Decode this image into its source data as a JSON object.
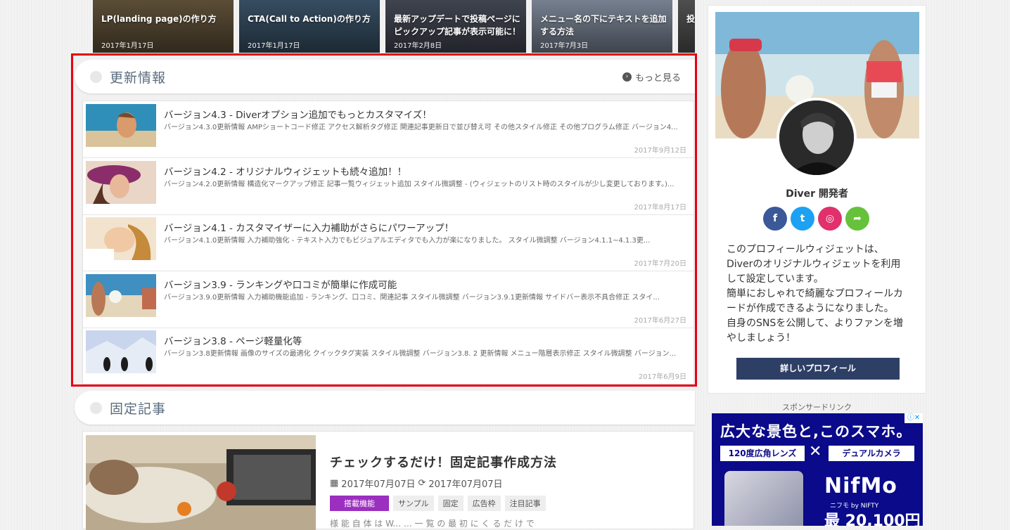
{
  "carousel": [
    {
      "title": "LP(landing page)の作り方",
      "date": "2017年1月17日",
      "bg": "#6b5a3f"
    },
    {
      "title": "CTA(Call to Action)の作り方",
      "date": "2017年1月17日",
      "bg": "#3f5a72"
    },
    {
      "title": "最新アップデートで投稿ページにピックアップ記事が表示可能に！",
      "date": "2017年2月8日",
      "bg": "#4a4f5c"
    },
    {
      "title": "メニュー名の下にテキストを追加する方法",
      "date": "2017年7月3日",
      "bg": "#8a96a8"
    },
    {
      "title": "投公",
      "date": "",
      "bg": "#5c5c5c"
    }
  ],
  "updates": {
    "heading": "更新情報",
    "more_label": "もっと見る",
    "items": [
      {
        "title": "バージョン4.3 - Diverオプション追加でもっとカスタマイズ！",
        "excerpt": "バージョン4.3.0更新情報 AMPショートコード修正 アクセス解析タグ修正 関連記事更新日で並び替え可 その他スタイル修正 その他プログラム修正 バージョン4...",
        "date": "2017年9月12日"
      },
      {
        "title": "バージョン4.2 - オリジナルウィジェットも続々追加！！",
        "excerpt": "バージョン4.2.0更新情報 構造化マークアップ修正 記事一覧ウィジェット追加 スタイル微調整 - (ウィジェットのリスト時のスタイルが少し変更しております。)...",
        "date": "2017年8月17日"
      },
      {
        "title": "バージョン4.1 - カスタマイザーに入力補助がさらにパワーアップ！",
        "excerpt": "バージョン4.1.0更新情報 入力補助強化 - テキスト入力でもビジュアルエディタでも入力が楽になりました。 スタイル微調整 バージョン4.1.1~4.1.3更...",
        "date": "2017年7月20日"
      },
      {
        "title": "バージョン3.9 - ランキングや口コミが簡単に作成可能",
        "excerpt": "バージョン3.9.0更新情報 入力補助機能追加 - ランキング、口コミ、関連記事 スタイル微調整 バージョン3.9.1更新情報 サイドバー表示不具合修正 スタイ...",
        "date": "2017年6月27日"
      },
      {
        "title": "バージョン3.8 - ページ軽量化等",
        "excerpt": "バージョン3.8更新情報 画像のサイズの最適化 クイックタグ実装 スタイル微調整 バージョン3.8. 2 更新情報 メニュー階層表示修正 スタイル微調整 バージョン...",
        "date": "2017年6月9日"
      }
    ]
  },
  "fixed": {
    "heading": "固定記事",
    "article_title": "チェックするだけ！固定記事作成方法",
    "published": "2017年07月07日",
    "updated": "2017年07月07日",
    "category": "搭載機能",
    "tags": [
      "サンプル",
      "固定",
      "広告枠",
      "注目記事"
    ],
    "excerpt_cut": "様 能 自 体 は W...              …                              一 覧 の 最 初 に く る だ け で"
  },
  "profile": {
    "name": "Diver 開発者",
    "socials": [
      {
        "icon": "f",
        "color": "#3b5998",
        "name": "facebook-icon"
      },
      {
        "icon": "t",
        "color": "#1da1f2",
        "name": "twitter-icon"
      },
      {
        "icon": "◎",
        "color": "#e1306c",
        "name": "instagram-icon"
      },
      {
        "icon": "➦",
        "color": "#65c23a",
        "name": "share-icon"
      }
    ],
    "description_lines": [
      "このプロフィールウィジェットは、",
      "Diverのオリジナルウィジェットを利用",
      "して設定しています。",
      "簡単におしゃれで綺麗なプロフィールカ",
      "ードが作成できるようになりました。",
      "自身のSNSを公開して、よりファンを増",
      "やしましょう！"
    ],
    "button_label": "詳しいプロフィール"
  },
  "sponsor": {
    "label": "スポンサードリンク",
    "ad_headline": "広大な景色と,このスマホ。",
    "ad_badge_left": "120度広角レンズ",
    "ad_badge_right": "デュアルカメラ",
    "ad_brand": "NifMo",
    "ad_sub": "ニフモ by NIFTY",
    "ad_price": "最 20,100円"
  }
}
